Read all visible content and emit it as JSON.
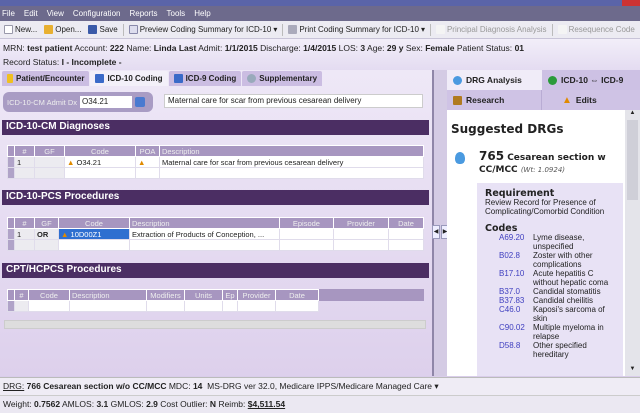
{
  "menu": [
    "File",
    "Edit",
    "View",
    "Configuration",
    "Reports",
    "Tools",
    "Help"
  ],
  "toolbar": {
    "new": "New...",
    "open": "Open...",
    "save": "Save",
    "preview": "Preview Coding Summary for ICD-10",
    "print": "Print Coding Summary for ICD-10",
    "principal": "Principal Diagnosis Analysis",
    "resequence": "Resequence Code"
  },
  "patient": {
    "mrn_label": "MRN:",
    "mrn": "test patient",
    "account_label": "Account:",
    "account": "222",
    "name_label": "Name:",
    "name": "Linda Last",
    "admit_label": "Admit:",
    "admit": "1/1/2015",
    "discharge_label": "Discharge:",
    "discharge": "1/4/2015",
    "los_label": "LOS:",
    "los": "3",
    "age_label": "Age:",
    "age": "29 y",
    "sex_label": "Sex:",
    "sex": "Female",
    "status_label": "Patient Status:",
    "status": "01",
    "record_label": "Record Status:",
    "record": "I - Incomplete -"
  },
  "tabs": [
    "Patient/Encounter",
    "ICD-10 Coding",
    "ICD-9 Coding",
    "Supplementary"
  ],
  "admit_dx": {
    "label": "ICD-10-CM Admit Dx",
    "code": "O34.21",
    "description": "Maternal care for scar from previous cesarean delivery"
  },
  "diagnoses": {
    "title": "ICD-10-CM Diagnoses",
    "columns": [
      "#",
      "GF",
      "Code",
      "POA",
      "Description"
    ],
    "rows": [
      {
        "n": "1",
        "gf": "",
        "code": "O34.21",
        "poa": "",
        "desc": "Maternal care for scar from previous cesarean delivery"
      }
    ]
  },
  "pcs": {
    "title": "ICD-10-PCS Procedures",
    "columns": [
      "#",
      "GF",
      "Code",
      "Description",
      "Episode",
      "Provider",
      "Date"
    ],
    "rows": [
      {
        "n": "1",
        "gf": "OR",
        "code": "10D00Z1",
        "desc": "Extraction of Products of Conception, ..."
      }
    ]
  },
  "cpt": {
    "title": "CPT/HCPCS Procedures",
    "columns": [
      "#",
      "Code",
      "Description",
      "Modifiers",
      "Units",
      "Ep",
      "Provider",
      "Date"
    ]
  },
  "right": {
    "tabs": [
      "DRG Analysis",
      "ICD-10 ⇔ ICD-9"
    ],
    "subtabs": [
      "Research",
      "Edits"
    ],
    "heading": "Suggested DRGs",
    "drg_num": "765",
    "drg_title": "Cesarean section w CC/MCC",
    "drg_wt": "(Wt: 1.0924)",
    "req_title": "Requirement",
    "req_text": "Review Record for Presence of Complicating/Comorbid Condition",
    "codes_title": "Codes",
    "codes": [
      {
        "c": "A69.20",
        "d": "Lyme disease, unspecified"
      },
      {
        "c": "B02.8",
        "d": "Zoster with other complications"
      },
      {
        "c": "B17.10",
        "d": "Acute hepatitis C without hepatic coma"
      },
      {
        "c": "B37.0",
        "d": "Candidal stomatitis"
      },
      {
        "c": "B37.83",
        "d": "Candidal cheilitis"
      },
      {
        "c": "C46.0",
        "d": "Kaposi's sarcoma of skin"
      },
      {
        "c": "C90.02",
        "d": "Multiple myeloma in relapse"
      },
      {
        "c": "D58.8",
        "d": "Other specified hereditary"
      }
    ]
  },
  "status": {
    "drg_label": "DRG:",
    "drg": "766",
    "drg_desc": "Cesarean section w/o CC/MCC",
    "mdc_label": "MDC:",
    "mdc": "14",
    "grouper": "MS-DRG ver 32.0, Medicare IPPS/Medicare Managed Care",
    "weight_label": "Weight:",
    "weight": "0.7562",
    "amlos_label": "AMLOS:",
    "amlos": "3.1",
    "gmlos_label": "GMLOS:",
    "gmlos": "2.9",
    "outlier_label": "Cost Outlier:",
    "outlier": "N",
    "reimb_label": "Reimb:",
    "reimb": "$4,511.54"
  }
}
